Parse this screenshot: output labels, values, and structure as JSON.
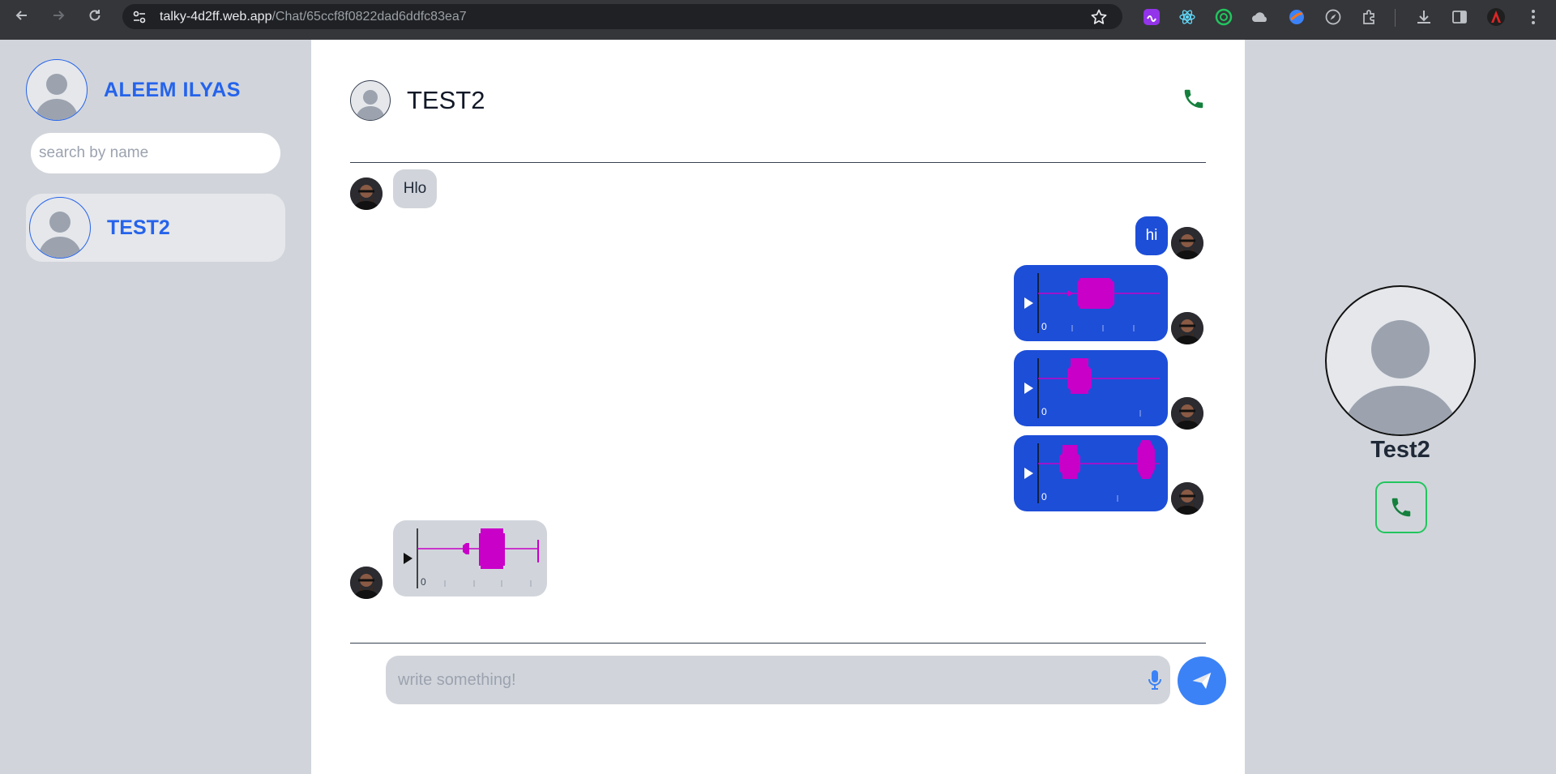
{
  "browser": {
    "url_host": "talky-4d2ff.web.app",
    "url_path": "/Chat/65ccf8f0822dad6ddfc83ea7",
    "extensions": [
      "extension-purple-icon",
      "react-devtools-icon",
      "extension-ring-icon",
      "extension-cloud-icon",
      "extension-orb-icon",
      "extension-compass-icon",
      "extensions-puzzle-icon"
    ]
  },
  "sidebar": {
    "user_name": "ALEEM ILYAS",
    "search_placeholder": "search by name",
    "contacts": [
      {
        "name": "TEST2"
      }
    ]
  },
  "chat": {
    "contact_name": "TEST2",
    "messages": [
      {
        "direction": "incoming",
        "type": "text",
        "text": "Hlo"
      },
      {
        "direction": "outgoing",
        "type": "text",
        "text": "hi"
      },
      {
        "direction": "outgoing",
        "type": "audio",
        "time_label": "0"
      },
      {
        "direction": "outgoing",
        "type": "audio",
        "time_label": "0"
      },
      {
        "direction": "outgoing",
        "type": "audio",
        "time_label": "0"
      },
      {
        "direction": "incoming",
        "type": "audio",
        "time_label": "0"
      }
    ],
    "composer_placeholder": "write something!"
  },
  "profile": {
    "name": "Test2"
  },
  "colors": {
    "accent_blue": "#2563eb",
    "outgoing_bubble": "#1d4ed8",
    "incoming_bubble": "#d1d5db",
    "waveform": "#c800c8",
    "call_green": "#15803d",
    "send_button": "#3b82f6"
  }
}
